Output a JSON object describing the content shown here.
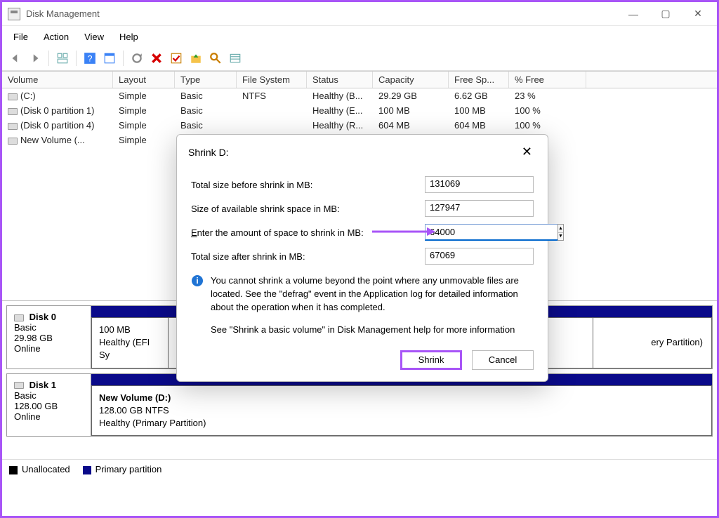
{
  "window": {
    "title": "Disk Management",
    "min": "—",
    "max": "▢",
    "close": "✕"
  },
  "menu": {
    "file": "File",
    "action": "Action",
    "view": "View",
    "help": "Help"
  },
  "columns": {
    "volume": "Volume",
    "layout": "Layout",
    "type": "Type",
    "fs": "File System",
    "status": "Status",
    "capacity": "Capacity",
    "free": "Free Sp...",
    "pfree": "% Free"
  },
  "rows": [
    {
      "volume": "(C:)",
      "layout": "Simple",
      "type": "Basic",
      "fs": "NTFS",
      "status": "Healthy (B...",
      "capacity": "29.29 GB",
      "free": "6.62 GB",
      "pfree": "23 %"
    },
    {
      "volume": "(Disk 0 partition 1)",
      "layout": "Simple",
      "type": "Basic",
      "fs": "",
      "status": "Healthy (E...",
      "capacity": "100 MB",
      "free": "100 MB",
      "pfree": "100 %"
    },
    {
      "volume": "(Disk 0 partition 4)",
      "layout": "Simple",
      "type": "Basic",
      "fs": "",
      "status": "Healthy (R...",
      "capacity": "604 MB",
      "free": "604 MB",
      "pfree": "100 %"
    },
    {
      "volume": "New Volume (...",
      "layout": "Simple",
      "type": "",
      "fs": "",
      "status": "",
      "capacity": "",
      "free": "",
      "pfree": ""
    }
  ],
  "disk0": {
    "name": "Disk 0",
    "type": "Basic",
    "size": "29.98 GB",
    "state": "Online",
    "p1_size": "100 MB",
    "p1_state": "Healthy (EFI Sy",
    "p4_state": "ery Partition)"
  },
  "disk1": {
    "name": "Disk 1",
    "type": "Basic",
    "size": "128.00 GB",
    "state": "Online",
    "vol_name": "New Volume  (D:)",
    "vol_size": "128.00 GB NTFS",
    "vol_state": "Healthy (Primary Partition)"
  },
  "legend": {
    "un": "Unallocated",
    "pp": "Primary partition"
  },
  "dialog": {
    "title": "Shrink D:",
    "close": "✕",
    "lbl_total": "Total size before shrink in MB:",
    "val_total": "131069",
    "lbl_avail": "Size of available shrink space in MB:",
    "val_avail": "127947",
    "lbl_enter_pre": "E",
    "lbl_enter_post": "nter the amount of space to shrink in MB:",
    "val_enter": "64000",
    "lbl_after": "Total size after shrink in MB:",
    "val_after": "67069",
    "info": "You cannot shrink a volume beyond the point where any unmovable files are located. See the \"defrag\" event in the Application log for detailed information about the operation when it has completed.",
    "help": "See \"Shrink a basic volume\" in Disk Management help for more information",
    "btn_shrink": "Shrink",
    "btn_cancel": "Cancel"
  }
}
